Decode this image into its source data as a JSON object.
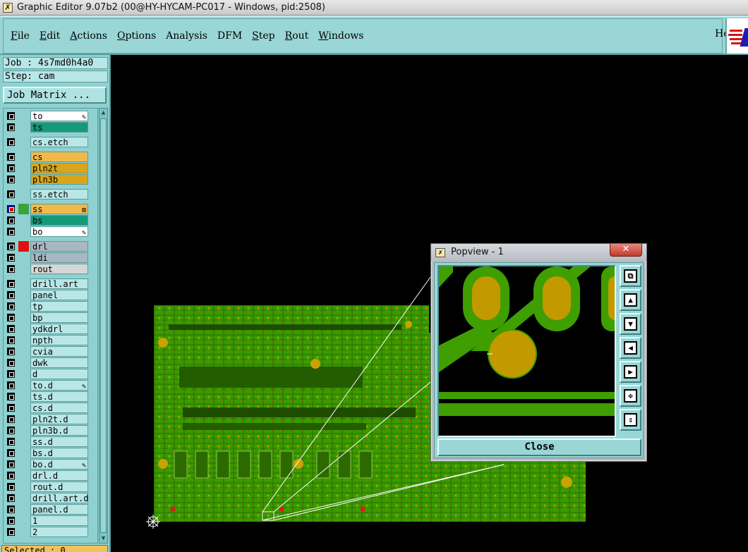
{
  "window": {
    "title": "Graphic Editor 9.07b2 (00@HY-HYCAM-PC017 - Windows, pid:2508)"
  },
  "menubar": {
    "items": [
      {
        "label": "File",
        "underline": "F",
        "rest": "ile"
      },
      {
        "label": "Edit",
        "underline": "E",
        "rest": "dit"
      },
      {
        "label": "Actions",
        "underline": "A",
        "rest": "ctions"
      },
      {
        "label": "Options",
        "underline": "O",
        "rest": "ptions"
      },
      {
        "label": "Analysis",
        "underline": "",
        "rest": "Analysis"
      },
      {
        "label": "DFM",
        "underline": "",
        "rest": "DFM"
      },
      {
        "label": "Step",
        "underline": "S",
        "rest": "tep"
      },
      {
        "label": "Rout",
        "underline": "R",
        "rest": "out"
      },
      {
        "label": "Windows",
        "underline": "W",
        "rest": "indows"
      }
    ],
    "help_label": "Help"
  },
  "leftpanel": {
    "job": "Job : 4s7md0h4a0",
    "step": "Step: cam",
    "job_matrix_label": "Job Matrix ...",
    "selected": "Selected : 0",
    "layers": [
      {
        "name": "to",
        "bg": "#ffffff",
        "swatch": "",
        "cb": "",
        "mark": "✎"
      },
      {
        "name": "ts",
        "bg": "#159a78",
        "swatch": "",
        "cb": "",
        "mark": ""
      },
      {
        "name": "cs.etch",
        "bg": "#b9e6e6",
        "swatch": "",
        "cb": "",
        "mark": ""
      },
      {
        "name": "cs",
        "bg": "#f1b94a",
        "swatch": "",
        "cb": "",
        "mark": ""
      },
      {
        "name": "pln2t",
        "bg": "#d9a51a",
        "swatch": "",
        "cb": "",
        "mark": ""
      },
      {
        "name": "pln3b",
        "bg": "#d9a51a",
        "swatch": "",
        "cb": "",
        "mark": ""
      },
      {
        "name": "ss.etch",
        "bg": "#b9e6e6",
        "swatch": "",
        "cb": "",
        "mark": ""
      },
      {
        "name": "ss",
        "bg": "#f1b94a",
        "swatch": "#3aa33a",
        "cb": "blue",
        "mark": "⊞"
      },
      {
        "name": "bs",
        "bg": "#159a78",
        "swatch": "",
        "cb": "",
        "mark": ""
      },
      {
        "name": "bo",
        "bg": "#ffffff",
        "swatch": "",
        "cb": "",
        "mark": "✎"
      },
      {
        "name": "drl",
        "bg": "#a9b7c2",
        "swatch": "#e01010",
        "cb": "",
        "mark": ""
      },
      {
        "name": "ldi",
        "bg": "#a9b7c2",
        "swatch": "",
        "cb": "",
        "mark": ""
      },
      {
        "name": "rout",
        "bg": "#d6d6d6",
        "swatch": "",
        "cb": "",
        "mark": ""
      },
      {
        "name": "drill.art",
        "bg": "#b9e6e6",
        "swatch": "",
        "cb": "",
        "mark": ""
      },
      {
        "name": "panel",
        "bg": "#b9e6e6",
        "swatch": "",
        "cb": "",
        "mark": ""
      },
      {
        "name": "tp",
        "bg": "#b9e6e6",
        "swatch": "",
        "cb": "",
        "mark": ""
      },
      {
        "name": "bp",
        "bg": "#b9e6e6",
        "swatch": "",
        "cb": "",
        "mark": ""
      },
      {
        "name": "ydkdrl",
        "bg": "#b9e6e6",
        "swatch": "",
        "cb": "",
        "mark": ""
      },
      {
        "name": "npth",
        "bg": "#b9e6e6",
        "swatch": "",
        "cb": "",
        "mark": ""
      },
      {
        "name": "cvia",
        "bg": "#b9e6e6",
        "swatch": "",
        "cb": "",
        "mark": ""
      },
      {
        "name": "dwk",
        "bg": "#b9e6e6",
        "swatch": "",
        "cb": "",
        "mark": ""
      },
      {
        "name": "d",
        "bg": "#b9e6e6",
        "swatch": "",
        "cb": "",
        "mark": ""
      },
      {
        "name": "to.d",
        "bg": "#b9e6e6",
        "swatch": "",
        "cb": "",
        "mark": "✎"
      },
      {
        "name": "ts.d",
        "bg": "#b9e6e6",
        "swatch": "",
        "cb": "",
        "mark": ""
      },
      {
        "name": "cs.d",
        "bg": "#b9e6e6",
        "swatch": "",
        "cb": "",
        "mark": ""
      },
      {
        "name": "pln2t.d",
        "bg": "#b9e6e6",
        "swatch": "",
        "cb": "",
        "mark": ""
      },
      {
        "name": "pln3b.d",
        "bg": "#b9e6e6",
        "swatch": "",
        "cb": "",
        "mark": ""
      },
      {
        "name": "ss.d",
        "bg": "#b9e6e6",
        "swatch": "",
        "cb": "",
        "mark": ""
      },
      {
        "name": "bs.d",
        "bg": "#b9e6e6",
        "swatch": "",
        "cb": "",
        "mark": ""
      },
      {
        "name": "bo.d",
        "bg": "#b9e6e6",
        "swatch": "",
        "cb": "",
        "mark": "✎"
      },
      {
        "name": "drl.d",
        "bg": "#b9e6e6",
        "swatch": "",
        "cb": "",
        "mark": ""
      },
      {
        "name": "rout.d",
        "bg": "#b9e6e6",
        "swatch": "",
        "cb": "",
        "mark": ""
      },
      {
        "name": "drill.art.d",
        "bg": "#b9e6e6",
        "swatch": "",
        "cb": "",
        "mark": ""
      },
      {
        "name": "panel.d",
        "bg": "#b9e6e6",
        "swatch": "",
        "cb": "",
        "mark": ""
      },
      {
        "name": "1",
        "bg": "#b9e6e6",
        "swatch": "",
        "cb": "",
        "mark": ""
      },
      {
        "name": "2",
        "bg": "#b9e6e6",
        "swatch": "",
        "cb": "",
        "mark": ""
      }
    ]
  },
  "popview": {
    "title": "Popview - 1",
    "close_x": "✕",
    "close_label": "Close",
    "tools": [
      {
        "name": "zoom-home-icon",
        "glyph": "⧉"
      },
      {
        "name": "pan-up-icon",
        "glyph": "▲"
      },
      {
        "name": "pan-down-icon",
        "glyph": "▼"
      },
      {
        "name": "pan-left-icon",
        "glyph": "◀"
      },
      {
        "name": "pan-right-icon",
        "glyph": "▶"
      },
      {
        "name": "zoom-in-icon",
        "glyph": "✥"
      },
      {
        "name": "zoom-out-icon",
        "glyph": "⇕"
      }
    ]
  },
  "colors": {
    "copper": "#3f9e00",
    "pad": "#c29a00",
    "panel_bg": "#8fd0d0",
    "menu_bg": "#9ad6d6"
  }
}
